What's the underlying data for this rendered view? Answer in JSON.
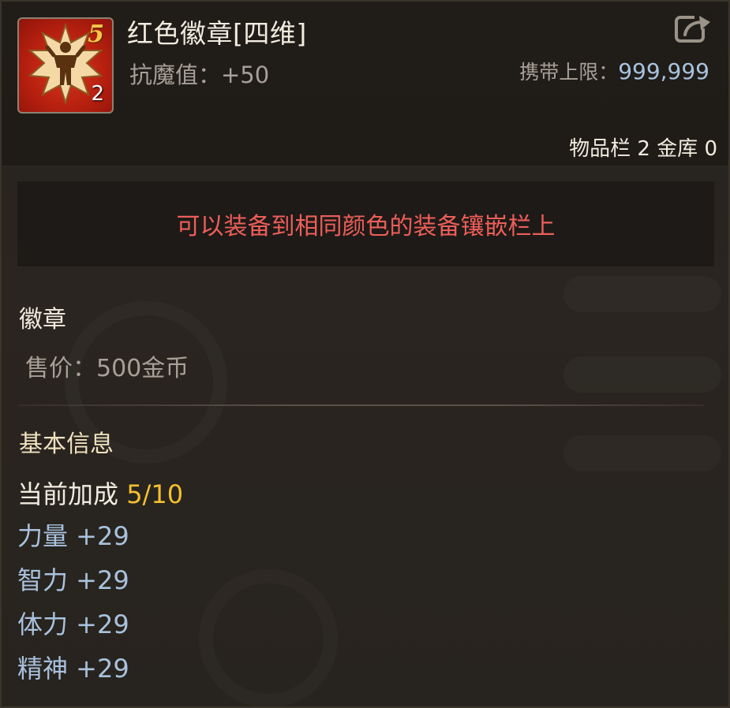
{
  "item": {
    "name": "红色徽章[四维]",
    "icon": "red-badge-icon",
    "level_badge": "5",
    "stack_count": "2",
    "attribute": "抗魔值：+50",
    "carry_limit_label": "携带上限：",
    "carry_limit_value": "999,999",
    "storage_text": "物品栏 2 金库 0"
  },
  "notice": "可以装备到相同颜色的装备镶嵌栏上",
  "category": "徽章",
  "price": "售价：500金币",
  "basic_info": {
    "title": "基本信息",
    "bonus_label": "当前加成",
    "bonus_value": "5/10",
    "stats": [
      {
        "label": "力量 +29"
      },
      {
        "label": "智力 +29"
      },
      {
        "label": "体力 +29"
      },
      {
        "label": "精神 +29"
      }
    ]
  },
  "colors": {
    "notice_red": "#ee5e5a",
    "bonus_gold": "#f4c02e",
    "stat_blue": "#a8c2de",
    "title_cream": "#f0e2bf"
  }
}
